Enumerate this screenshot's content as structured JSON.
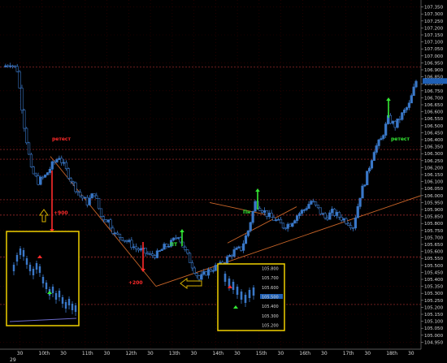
{
  "chart_data": {
    "type": "candlestick",
    "colors": {
      "background": "#000000",
      "up_candle": "#3a78c8",
      "grid": "#3a0000",
      "level_line": "#b03030",
      "trend_line": "#c86428",
      "annotation_red": "#ff2a2a",
      "annotation_green": "#34e834",
      "inset_border": "#f0d000",
      "hollow_arrow": "#d4b000"
    },
    "y_axis": {
      "range": [
        104.9,
        107.4
      ],
      "tick_labels": [
        "107.350",
        "107.300",
        "107.250",
        "107.200",
        "107.150",
        "107.100",
        "107.050",
        "107.000",
        "106.950",
        "106.900",
        "106.850",
        "106.800",
        "106.750",
        "106.700",
        "106.650",
        "106.600",
        "106.550",
        "106.500",
        "106.450",
        "106.400",
        "106.350",
        "106.300",
        "106.250",
        "106.200",
        "106.150",
        "106.100",
        "106.050",
        "106.000",
        "105.950",
        "105.900",
        "105.850",
        "105.800",
        "105.750",
        "105.700",
        "105.650",
        "105.600",
        "105.550",
        "105.500",
        "105.450",
        "105.400",
        "105.350",
        "105.300",
        "105.250",
        "105.200",
        "105.150",
        "105.100",
        "105.050",
        "105.000",
        "104.950"
      ]
    },
    "x_axis": {
      "tick_labels": [
        "30",
        "10th",
        "30",
        "11th",
        "30",
        "12th",
        "30",
        "13th",
        "30",
        "14th",
        "30",
        "15th",
        "30",
        "16th",
        "30",
        "17th",
        "30",
        "18th",
        "30"
      ],
      "secondary_label": "29"
    },
    "price_series": [
      106.92,
      106.95,
      106.9,
      106.5,
      106.18,
      106.1,
      106.14,
      106.22,
      106.28,
      106.18,
      106.08,
      106.0,
      105.95,
      106.02,
      105.85,
      105.82,
      105.72,
      105.7,
      105.66,
      105.62,
      105.6,
      105.57,
      105.58,
      105.63,
      105.66,
      105.72,
      105.6,
      105.5,
      105.4,
      105.45,
      105.48,
      105.5,
      105.55,
      105.6,
      105.62,
      105.75,
      105.95,
      105.9,
      105.85,
      105.82,
      105.78,
      105.8,
      105.86,
      105.9,
      105.96,
      105.9,
      105.84,
      105.88,
      105.85,
      105.82,
      105.78,
      106.0,
      106.15,
      106.33,
      106.4,
      106.55,
      106.5,
      106.58,
      106.65,
      106.82
    ],
    "annotations": [
      {
        "text": "ретест",
        "color": "red"
      },
      {
        "text": "+900",
        "color": "red"
      },
      {
        "text": "+200",
        "color": "red"
      },
      {
        "text": "ПТ",
        "color": "green"
      },
      {
        "text": "Пн",
        "color": "green"
      },
      {
        "text": "ретест",
        "color": "green"
      }
    ],
    "inset_right": {
      "tick_labels": [
        "105.800",
        "105.700",
        "105.600",
        "105.500",
        "105.400",
        "105.300",
        "105.200"
      ],
      "highlighted_label": "105.500"
    }
  }
}
